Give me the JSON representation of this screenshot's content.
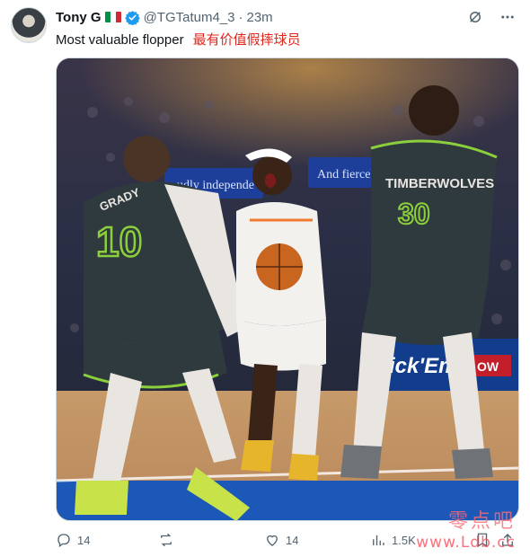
{
  "tweet": {
    "display_name": "Tony G",
    "handle": "@TGTatum4_3",
    "separator": "·",
    "time": "23m",
    "text": "Most valuable flopper",
    "translation": "最有价值假摔球员"
  },
  "media": {
    "banner_left": "udly independe",
    "banner_right": "And fiercely pro",
    "jersey_left_name": "GRADY",
    "jersey_left_number": "10",
    "jersey_right_team": "TIMBERWOLVES",
    "jersey_right_number": "30",
    "ad_board_right": "Pick'Em",
    "ad_board_right2": "OW"
  },
  "actions": {
    "reply_count": "14",
    "retweet_count": "",
    "like_count": "14",
    "views_count": "1.5K"
  },
  "watermark": {
    "line1": "零点吧",
    "line2": "www.Ldb.cc"
  },
  "colors": {
    "text": "#0f1419",
    "secondary": "#536471",
    "verified": "#1d9bf0",
    "translation": "#e0251b",
    "court_blue": "#1b58b8",
    "wolves_jersey": "#2f3a3e",
    "wolves_trim": "#8ccf3c"
  },
  "icons": {
    "verified": "verified-badge-icon",
    "grok": "grok-icon",
    "more": "more-icon",
    "reply": "reply-icon",
    "retweet": "retweet-icon",
    "like": "heart-icon",
    "views": "views-icon",
    "bookmark": "bookmark-icon",
    "share": "share-icon"
  }
}
